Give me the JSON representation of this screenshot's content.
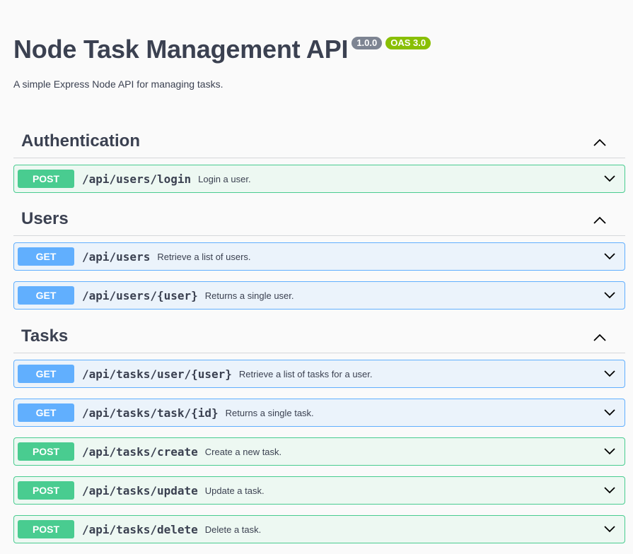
{
  "info": {
    "title": "Node Task Management API",
    "version": "1.0.0",
    "oas": "OAS 3.0",
    "description": "A simple Express Node API for managing tasks."
  },
  "colors": {
    "post": "#49cc90",
    "get": "#61affe",
    "text": "#3b4151",
    "badge_version": "#7d8492",
    "badge_oas": "#89bf04"
  },
  "icons": {
    "section_toggle": "chevron-up-icon",
    "operation_toggle": "chevron-down-icon"
  },
  "sections": [
    {
      "name": "Authentication",
      "operations": [
        {
          "method": "POST",
          "path": "/api/users/login",
          "summary": "Login a user."
        }
      ]
    },
    {
      "name": "Users",
      "operations": [
        {
          "method": "GET",
          "path": "/api/users",
          "summary": "Retrieve a list of users."
        },
        {
          "method": "GET",
          "path": "/api/users/{user}",
          "summary": "Returns a single user."
        }
      ]
    },
    {
      "name": "Tasks",
      "operations": [
        {
          "method": "GET",
          "path": "/api/tasks/user/{user}",
          "summary": "Retrieve a list of tasks for a user."
        },
        {
          "method": "GET",
          "path": "/api/tasks/task/{id}",
          "summary": "Returns a single task."
        },
        {
          "method": "POST",
          "path": "/api/tasks/create",
          "summary": "Create a new task."
        },
        {
          "method": "POST",
          "path": "/api/tasks/update",
          "summary": "Update a task."
        },
        {
          "method": "POST",
          "path": "/api/tasks/delete",
          "summary": "Delete a task."
        }
      ]
    }
  ]
}
